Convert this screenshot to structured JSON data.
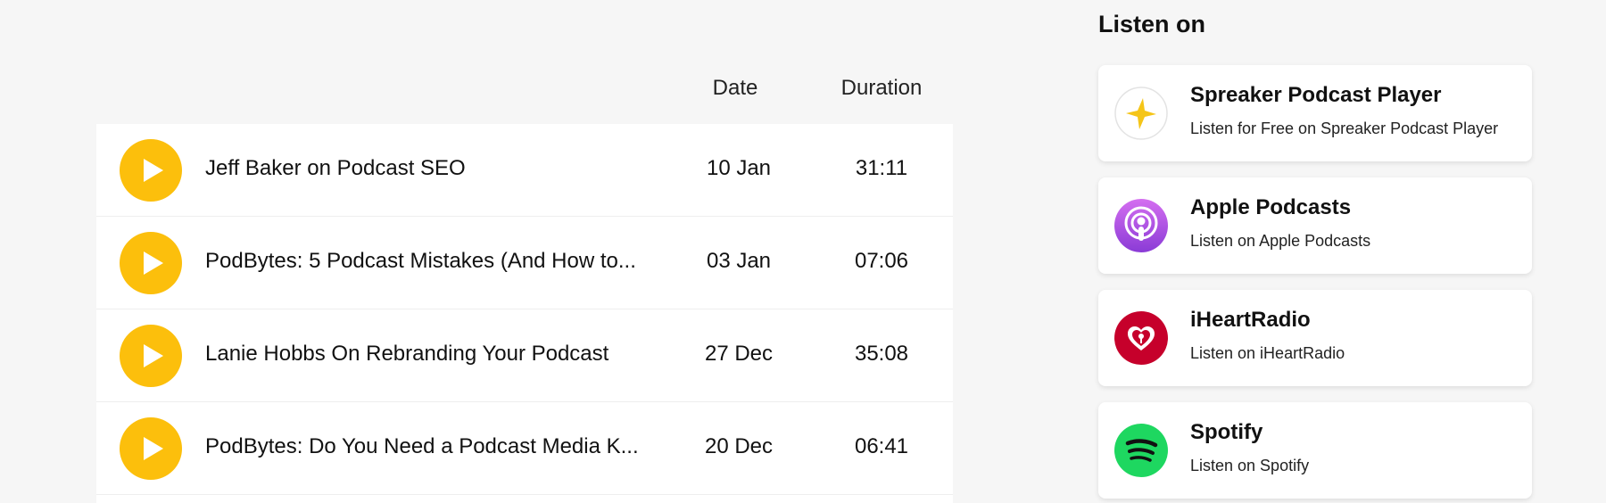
{
  "episodes": {
    "columns": {
      "date": "Date",
      "duration": "Duration"
    },
    "items": [
      {
        "title": "Jeff Baker on Podcast SEO",
        "date": "10 Jan",
        "duration": "31:11"
      },
      {
        "title": "PodBytes: 5 Podcast Mistakes (And How to...",
        "date": "03 Jan",
        "duration": "07:06"
      },
      {
        "title": "Lanie Hobbs On Rebranding Your Podcast",
        "date": "27 Dec",
        "duration": "35:08"
      },
      {
        "title": "PodBytes: Do You Need a Podcast Media K...",
        "date": "20 Dec",
        "duration": "06:41"
      }
    ],
    "accent_color": "#fcbf0c"
  },
  "listen_on": {
    "title": "Listen on",
    "platforms": [
      {
        "name": "Spreaker Podcast Player",
        "subtitle": "Listen for Free on Spreaker Podcast Player",
        "icon": "spreaker-star-icon",
        "color": "#f5c518"
      },
      {
        "name": "Apple Podcasts",
        "subtitle": "Listen on Apple Podcasts",
        "icon": "apple-podcasts-icon",
        "color": "#9b4ddb"
      },
      {
        "name": "iHeartRadio",
        "subtitle": "Listen on iHeartRadio",
        "icon": "iheartradio-icon",
        "color": "#c6002b"
      },
      {
        "name": "Spotify",
        "subtitle": "Listen on Spotify",
        "icon": "spotify-icon",
        "color": "#1ed760"
      }
    ]
  }
}
